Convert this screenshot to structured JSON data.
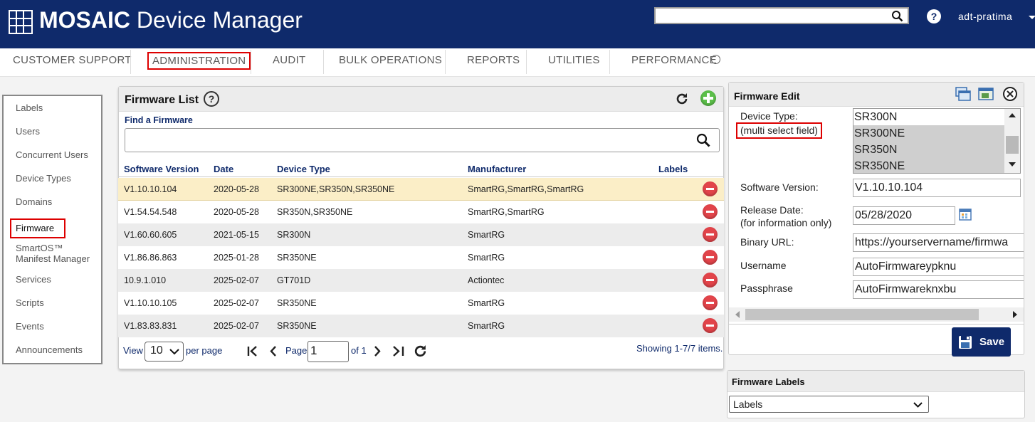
{
  "header": {
    "brand_bold": "MOSAIC",
    "brand_rest": " Device Manager",
    "search_value": "",
    "help": "?",
    "user": "adt-pratima"
  },
  "nav": [
    "CUSTOMER SUPPORT",
    "ADMINISTRATION",
    "AUDIT",
    "BULK OPERATIONS",
    "REPORTS",
    "UTILITIES",
    "PERFORMANCE"
  ],
  "sidebar": [
    "Labels",
    "Users",
    "Concurrent Users",
    "Device Types",
    "Domains",
    "Firmware",
    "SmartOS™",
    "Manifest Manager",
    "Services",
    "Scripts",
    "Events",
    "Announcements"
  ],
  "list": {
    "title": "Firmware List",
    "help": "?",
    "find_label": "Find a Firmware",
    "find_value": "",
    "columns": [
      "Software Version",
      "Date",
      "Device Type",
      "Manufacturer",
      "Labels"
    ],
    "rows": [
      [
        "V1.10.10.104",
        "2020-05-28",
        "SR300NE,SR350N,SR350NE",
        "SmartRG,SmartRG,SmartRG"
      ],
      [
        "V1.54.54.548",
        "2020-05-28",
        "SR350N,SR350NE",
        "SmartRG,SmartRG"
      ],
      [
        "V1.60.60.605",
        "2021-05-15",
        "SR300N",
        "SmartRG"
      ],
      [
        "V1.86.86.863",
        "2025-01-28",
        "SR350NE",
        "SmartRG"
      ],
      [
        "10.9.1.010",
        "2025-02-07",
        "GT701D",
        "Actiontec"
      ],
      [
        "V1.10.10.105",
        "2025-02-07",
        "SR350NE",
        "SmartRG"
      ],
      [
        "V1.83.83.831",
        "2025-02-07",
        "SR350NE",
        "SmartRG"
      ]
    ],
    "pager": {
      "view": "View",
      "per_page_value": "10",
      "per_page": "per page",
      "page": "Page",
      "page_value": "1",
      "of": "of 1",
      "showing": "Showing 1-7/7 items."
    }
  },
  "edit": {
    "title": "Firmware Edit",
    "device_type_label": "Device Type:",
    "device_type_note": "(multi select field)",
    "device_options": [
      "SR300N",
      "SR300NE",
      "SR350N",
      "SR350NE"
    ],
    "sw_label": "Software Version:",
    "sw_value": "V1.10.10.104",
    "release_label": "Release Date:",
    "release_note": "(for information only)",
    "release_value": "05/28/2020",
    "url_label": "Binary URL:",
    "url_value": "https://yourservername/firmwa",
    "user_label": "Username",
    "user_value": "AutoFirmwareypknu",
    "pass_label": "Passphrase",
    "pass_value": "AutoFirmwareknxbu",
    "save": "Save"
  },
  "labels_panel": {
    "title": "Firmware Labels",
    "select_value": "Labels"
  }
}
